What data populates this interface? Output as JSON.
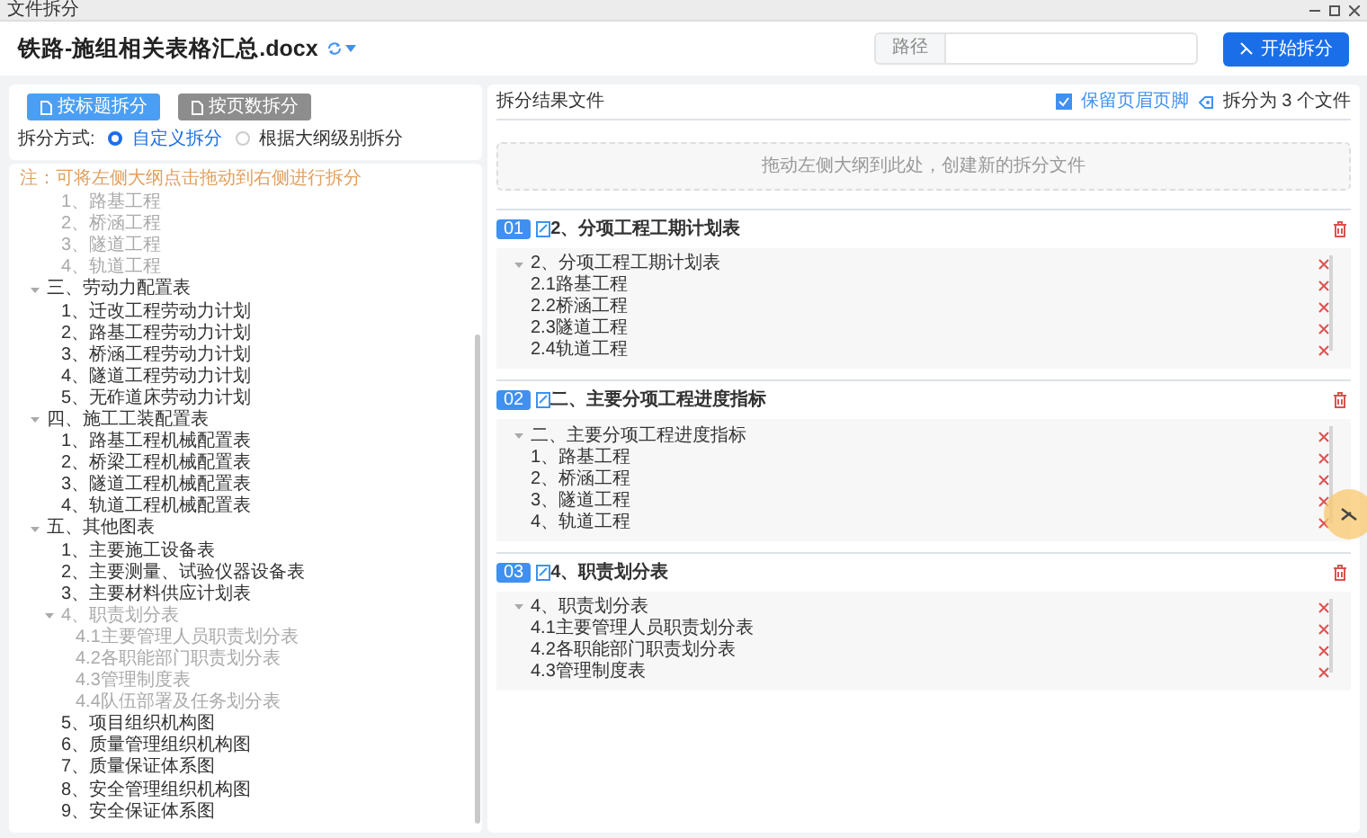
{
  "window": {
    "title": "文件拆分"
  },
  "header": {
    "file_name": "铁路-施组相关表格汇总.docx",
    "path_label": "路径",
    "start_button": "开始拆分"
  },
  "left": {
    "mode_buttons": [
      {
        "label": "按标题拆分",
        "selected": true
      },
      {
        "label": "按页数拆分",
        "selected": false
      }
    ],
    "split_mode": {
      "label": "拆分方式:",
      "options": [
        {
          "label": "自定义拆分",
          "selected": true
        },
        {
          "label": "根据大纲级别拆分",
          "selected": false
        }
      ]
    },
    "note": "注：可将左侧大纲点击拖动到右侧进行拆分",
    "outline": [
      {
        "children": [
          {
            "label": "1、路基工程",
            "used": true
          },
          {
            "label": "2、桥涵工程",
            "used": true
          },
          {
            "label": "3、隧道工程",
            "used": true
          },
          {
            "label": "4、轨道工程",
            "used": true
          }
        ]
      },
      {
        "label": "三、劳动力配置表",
        "used": false,
        "expanded": true,
        "children": [
          {
            "label": "1、迁改工程劳动力计划",
            "used": false
          },
          {
            "label": "2、路基工程劳动力计划",
            "used": false
          },
          {
            "label": "3、桥涵工程劳动力计划",
            "used": false
          },
          {
            "label": "4、隧道工程劳动力计划",
            "used": false
          },
          {
            "label": "5、无砟道床劳动力计划",
            "used": false
          }
        ]
      },
      {
        "label": "四、施工工装配置表",
        "used": false,
        "expanded": true,
        "children": [
          {
            "label": "1、路基工程机械配置表",
            "used": false
          },
          {
            "label": "2、桥梁工程机械配置表",
            "used": false
          },
          {
            "label": "3、隧道工程机械配置表",
            "used": false
          },
          {
            "label": "4、轨道工程机械配置表",
            "used": false
          }
        ]
      },
      {
        "label": "五、其他图表",
        "used": false,
        "expanded": true,
        "children": [
          {
            "label": "1、主要施工设备表",
            "used": false
          },
          {
            "label": "2、主要测量、试验仪器设备表",
            "used": false
          },
          {
            "label": "3、主要材料供应计划表",
            "used": false
          },
          {
            "label": "4、职责划分表",
            "used": true,
            "expanded": true,
            "children": [
              {
                "label": "4.1主要管理人员职责划分表",
                "used": true
              },
              {
                "label": "4.2各职能部门职责划分表",
                "used": true
              },
              {
                "label": "4.3管理制度表",
                "used": true
              },
              {
                "label": "4.4队伍部署及任务划分表",
                "used": true
              }
            ]
          },
          {
            "label": "5、项目组织机构图",
            "used": false
          },
          {
            "label": "6、质量管理组织机构图",
            "used": false
          },
          {
            "label": "7、质量保证体系图",
            "used": false
          },
          {
            "label": "8、安全管理组织机构图",
            "used": false
          },
          {
            "label": "9、安全保证体系图",
            "used": false
          }
        ]
      }
    ]
  },
  "right": {
    "title": "拆分结果文件",
    "keep_header_footer": {
      "label": "保留页眉页脚",
      "checked": true
    },
    "count_text": "拆分为 3 个文件",
    "drop_hint": "拖动左侧大纲到此处，创建新的拆分文件",
    "files": [
      {
        "index": "01",
        "title": "2、分项工程工期计划表",
        "items": [
          {
            "label": "2、分项工程工期计划表",
            "expanded": true,
            "children": [
              {
                "label": "2.1路基工程"
              },
              {
                "label": "2.2桥涵工程"
              },
              {
                "label": "2.3隧道工程"
              },
              {
                "label": "2.4轨道工程"
              }
            ]
          }
        ]
      },
      {
        "index": "02",
        "title": "二、主要分项工程进度指标",
        "items": [
          {
            "label": "二、主要分项工程进度指标",
            "expanded": true,
            "children": [
              {
                "label": "1、路基工程"
              },
              {
                "label": "2、桥涵工程"
              },
              {
                "label": "3、隧道工程"
              },
              {
                "label": "4、轨道工程"
              }
            ]
          }
        ]
      },
      {
        "index": "03",
        "title": "4、职责划分表",
        "items": [
          {
            "label": "4、职责划分表",
            "expanded": true,
            "children": [
              {
                "label": "4.1主要管理人员职责划分表"
              },
              {
                "label": "4.2各职能部门职责划分表"
              },
              {
                "label": "4.3管理制度表"
              }
            ]
          }
        ]
      }
    ]
  }
}
